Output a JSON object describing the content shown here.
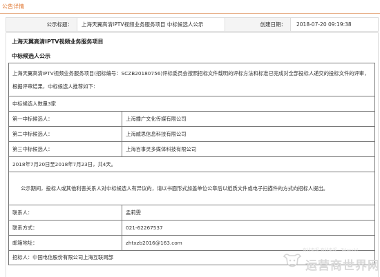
{
  "tab": {
    "label": "公告详情"
  },
  "meta": {
    "title_label": "公示标题：",
    "title_value": "上海天翼高清IPTV视频业务服务项目 中标候选人公示",
    "date_label": "创建日期：",
    "date_value": "2018-07-20 09:19:38"
  },
  "content": {
    "heading": "上海天翼高清IPTV视频业务服务项目",
    "subheading": "中标候选人公示",
    "intro": "上海天翼高清IPTV视频业务服务项目(招标编号：SCZB20180756)评标委员会按照招标文件载明的评标方法和标准已完成对全部投标人递交的投标文件的评审，根据评审结果，中标候选人推荐如下：",
    "count": "中标候选人数量3家",
    "candidates": [
      {
        "label": "第一中标候选人：",
        "value": "上海播广文化传媒有限公司"
      },
      {
        "label": "第二中标候选人：",
        "value": "上海威思信息科技有限公司"
      },
      {
        "label": "第三中标候选人：",
        "value": "上海百事灵多媒体科技有限公司"
      }
    ],
    "period": "2018年7月20日至2018年7月23日，共4天。",
    "notice": "公示期间，投标人或其他利害关系人对中标候选人有异议的，请以书面形式加盖单位公章后以纸质文件或电子扫描件的方式向招标人提出。",
    "contact_label": "联系人：",
    "contact_value": "孟莉雯",
    "phone_label": "联系方式：",
    "phone_value": "021-62267537",
    "email_label": "邮箱地址：",
    "email_value": "zhtxzb2016@163.com",
    "tenderer": "招标人：中国电信股份有限公司上海互联网部"
  },
  "watermark": {
    "line1": "· 有线电视 有线电视 · Telworld",
    "line2": "运营商世界网"
  }
}
